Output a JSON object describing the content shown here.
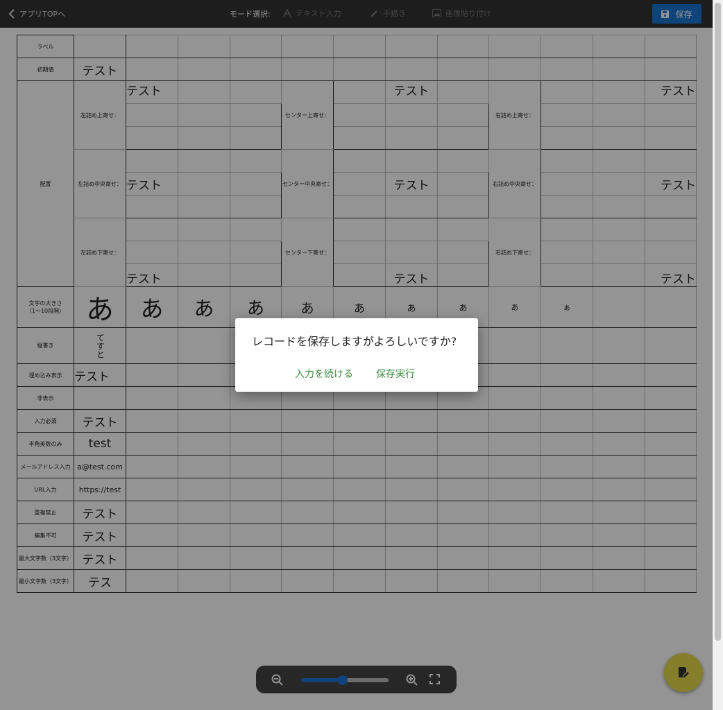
{
  "topbar": {
    "back_label": "アプリTOPへ",
    "mode_label": "モード選択:",
    "modes": [
      "テキスト入力",
      "手描き",
      "画像貼り付け"
    ],
    "save_label": "保存"
  },
  "sheet": {
    "rows": {
      "label": "ラベル",
      "initial": "初期値",
      "placement": "配置",
      "fontsize": "文字の大きさ\n（1〜10段階）",
      "vertical": "縦書き",
      "embedded": "埋め込み表示",
      "hidden": "非表示",
      "required": "入力必須",
      "halfwidth": "半角英数のみ",
      "email": "メールアドレス入力",
      "url": "URL入力",
      "nodup": "重複禁止",
      "noedit": "編集不可",
      "maxlen": "最大文字数（3文字）",
      "minlen": "最小文字数（3文字）"
    },
    "placement_sub": {
      "left_top": "左詰め上寄せ：",
      "center_top": "センター上寄せ：",
      "right_top": "右詰め上寄せ：",
      "left_mid": "左詰め中央寄せ：",
      "center_mid": "センター中央寄せ：",
      "right_mid": "右詰め中央寄せ：",
      "left_bot": "左詰め下寄せ：",
      "center_bot": "センター下寄せ：",
      "right_bot": "右詰め下寄せ："
    },
    "values": {
      "initial": "テスト",
      "test": "テスト",
      "glyph": "あ",
      "glyph_small": "ぁ",
      "vertical": "てすと",
      "embedded": "テスト",
      "required": "テスト",
      "halfwidth": "test",
      "email": "a@test.com",
      "url": "https://test",
      "nodup": "テスト",
      "noedit": "テスト",
      "maxlen": "テスト",
      "minlen": "テス"
    }
  },
  "dialog": {
    "message": "レコードを保存しますがよろしいですか?",
    "continue_label": "入力を続ける",
    "confirm_label": "保存実行"
  },
  "zoom": {
    "level": 0.48
  },
  "colors": {
    "accent": "#1976d2",
    "dialog_button": "#3e8e41",
    "fab": "#e6d94a"
  }
}
